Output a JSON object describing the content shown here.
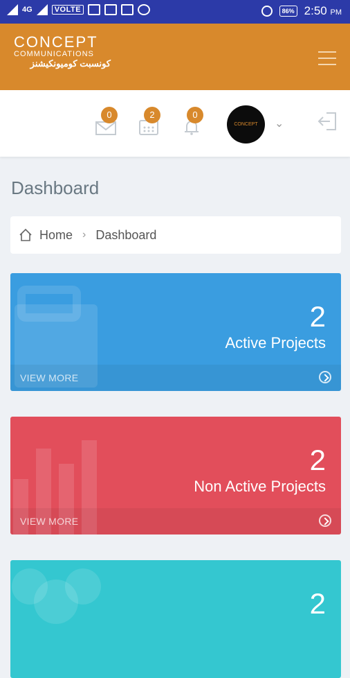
{
  "status_bar": {
    "network": "4G",
    "volte": "VOLTE",
    "battery": "86%",
    "time": "2:50",
    "ampm": "PM"
  },
  "header": {
    "logo_main": "CONCEPT",
    "logo_sub": "COMMUNICATIONS",
    "logo_arabic": "كونسبت كوميونكيشنز"
  },
  "topnav": {
    "mail_count": "0",
    "tasks_count": "2",
    "alerts_count": "0",
    "avatar_text": "CONCEPT"
  },
  "page": {
    "title": "Dashboard",
    "breadcrumb_home": "Home",
    "breadcrumb_current": "Dashboard"
  },
  "cards": [
    {
      "value": "2",
      "label": "Active Projects",
      "more": "VIEW MORE",
      "color": "#3a9de0"
    },
    {
      "value": "2",
      "label": "Non Active Projects",
      "more": "VIEW MORE",
      "color": "#e24e5b"
    },
    {
      "value": "2",
      "label": "",
      "more": "",
      "color": "#34c7d0"
    }
  ]
}
